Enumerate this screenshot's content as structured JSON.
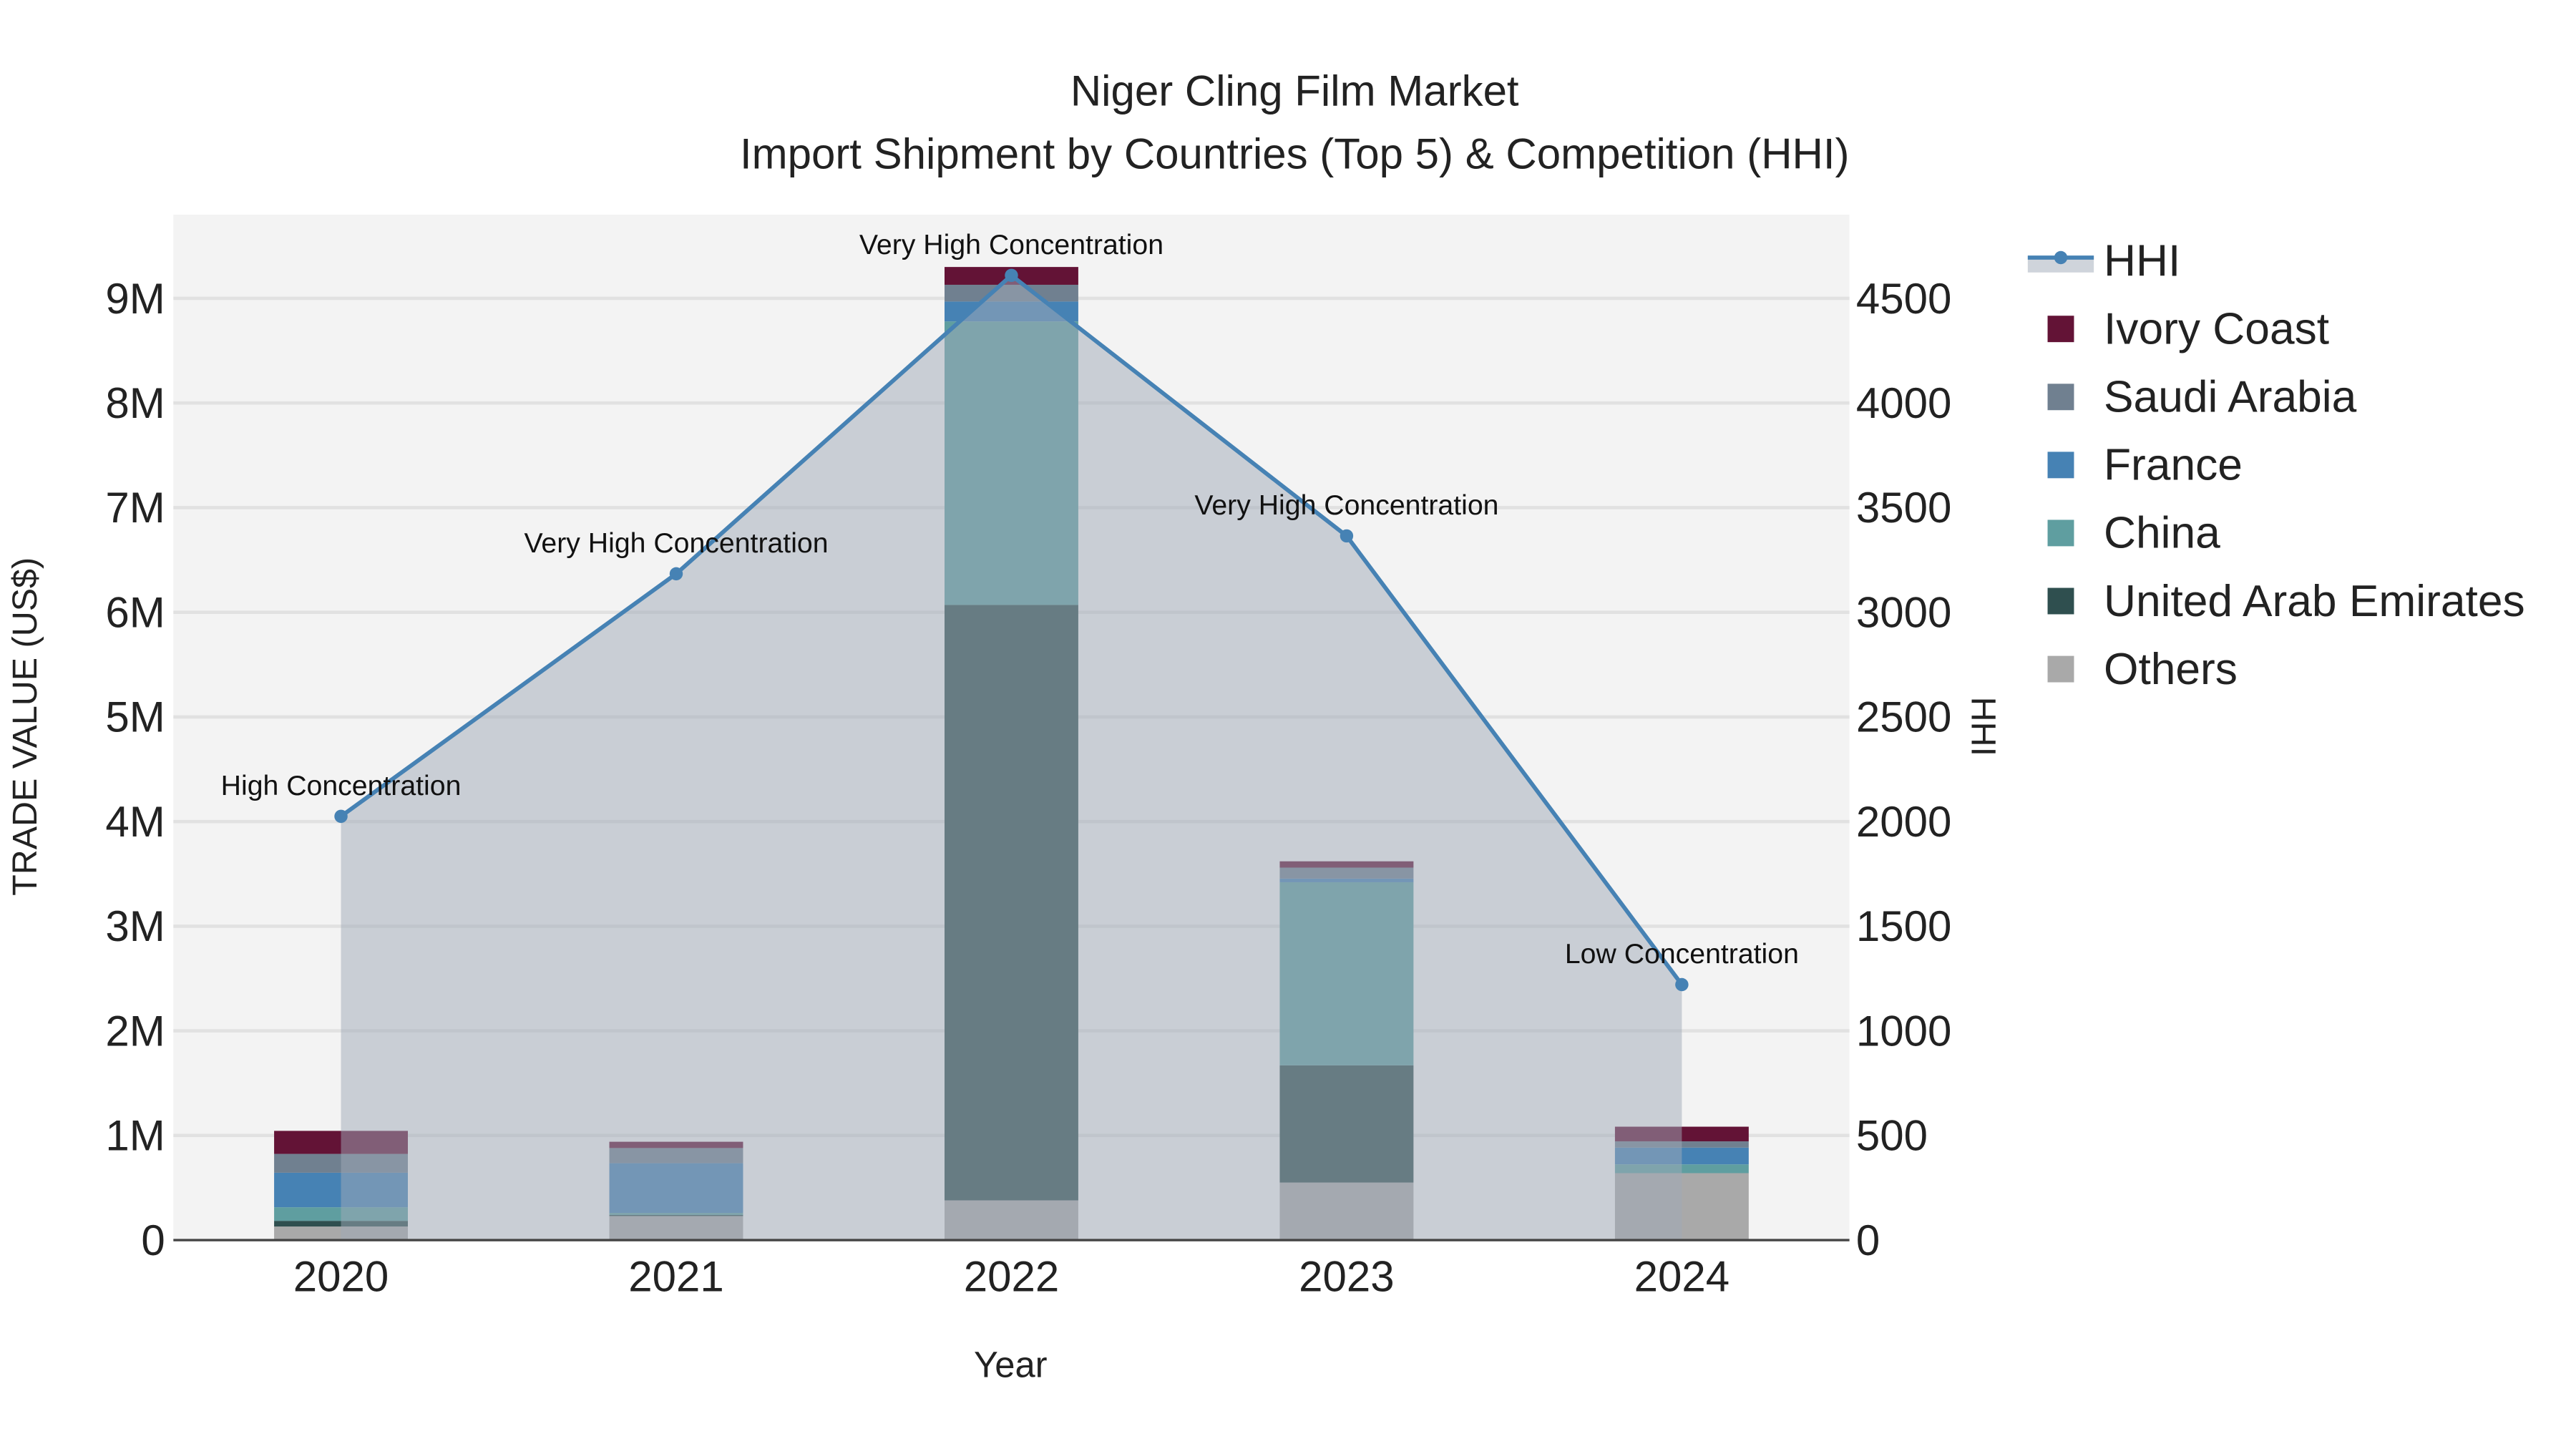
{
  "chart_data": {
    "type": "bar",
    "title": "Niger Cling Film Market",
    "subtitle": "Import Shipment by Countries (Top 5) & Competition (HHI)",
    "xlabel": "Year",
    "ylabel": "TRADE VALUE (US$)",
    "y2label": "HHI",
    "categories": [
      "2020",
      "2021",
      "2022",
      "2023",
      "2024"
    ],
    "ylim": [
      0,
      9800000
    ],
    "y2lim": [
      0,
      4900
    ],
    "y_ticks": [
      0,
      1000000,
      2000000,
      3000000,
      4000000,
      5000000,
      6000000,
      7000000,
      8000000,
      9000000
    ],
    "y_tick_labels": [
      "0",
      "1M",
      "2M",
      "3M",
      "4M",
      "5M",
      "6M",
      "7M",
      "8M",
      "9M"
    ],
    "y2_ticks": [
      0,
      500,
      1000,
      1500,
      2000,
      2500,
      3000,
      3500,
      4000,
      4500
    ],
    "y2_tick_labels": [
      "0",
      "500",
      "1000",
      "1500",
      "2000",
      "2500",
      "3000",
      "3500",
      "4000",
      "4500"
    ],
    "grid": true,
    "legend_placement": "right",
    "series": [
      {
        "name": "Others",
        "color": "#A9A9A9",
        "values": [
          130000,
          230000,
          380000,
          550000,
          640000
        ]
      },
      {
        "name": "United Arab Emirates",
        "color": "#2F4F4F",
        "values": [
          54000,
          10000,
          5690000,
          1120000,
          0
        ]
      },
      {
        "name": "China",
        "color": "#5F9EA0",
        "values": [
          130000,
          20000,
          2710000,
          1750000,
          84000
        ]
      },
      {
        "name": "France",
        "color": "#4682B4",
        "values": [
          330000,
          475000,
          190000,
          35000,
          160000
        ]
      },
      {
        "name": "Saudi Arabia",
        "color": "#708090",
        "values": [
          180000,
          145000,
          160000,
          105000,
          60000
        ]
      },
      {
        "name": "Ivory Coast",
        "color": "#631336",
        "values": [
          220000,
          60000,
          170000,
          60000,
          140000
        ]
      }
    ],
    "hhi": {
      "name": "HHI",
      "color": "#4682B4",
      "values": [
        2025,
        3184,
        4610,
        3365,
        1221
      ],
      "annotations": [
        "High Concentration",
        "Very High Concentration",
        "Very High Concentration",
        "Very High Concentration",
        "Low Concentration"
      ]
    },
    "legend": [
      "HHI",
      "Ivory Coast",
      "Saudi Arabia",
      "France",
      "China",
      "United Arab Emirates",
      "Others"
    ]
  }
}
